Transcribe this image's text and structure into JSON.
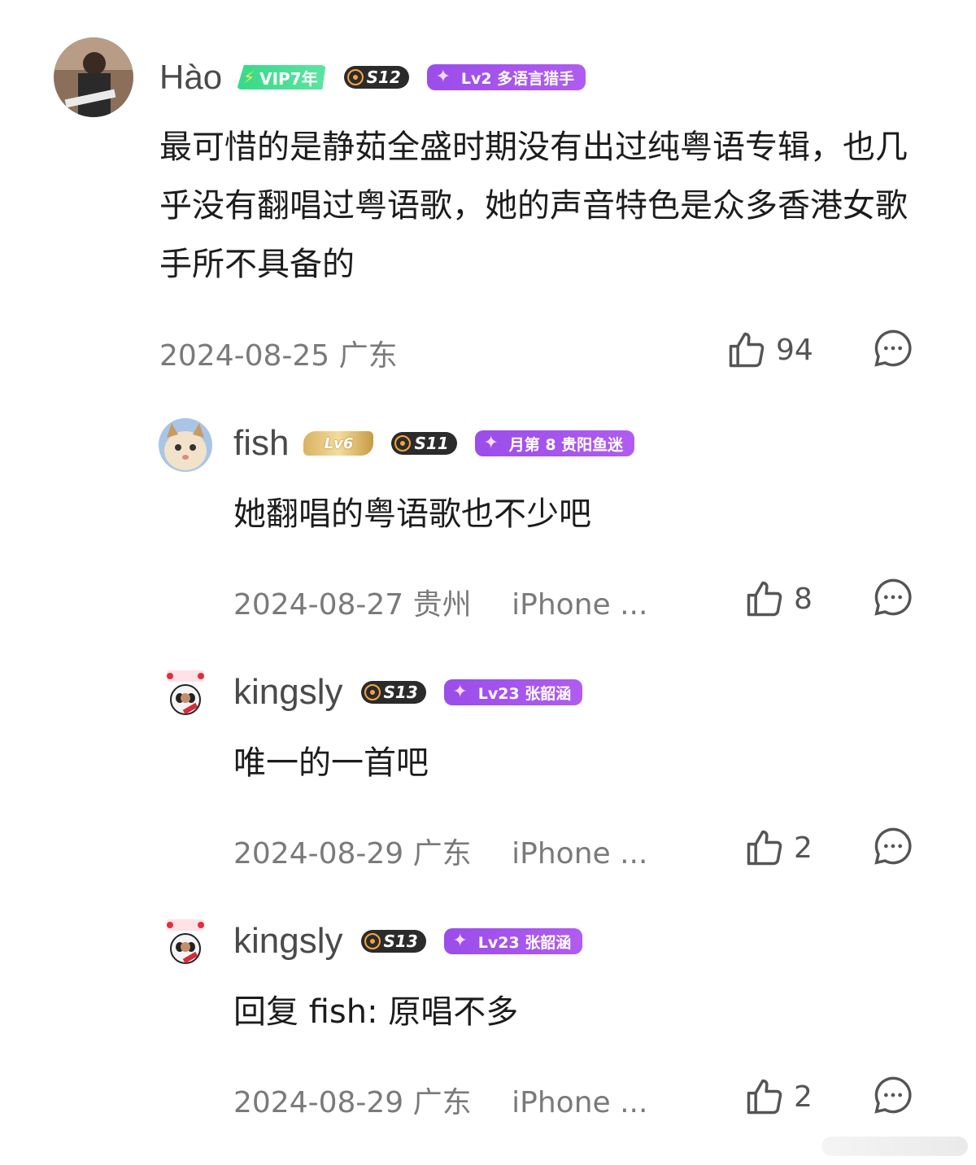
{
  "comments": [
    {
      "username": "Hào",
      "badges": {
        "vip": "VIP7年",
        "season": "S12",
        "fan": "Lv2 多语言猎手"
      },
      "text": "最可惜的是静茹全盛时期没有出过纯粤语专辑，也几乎没有翻唱过粤语歌，她的声音特色是众多香港女歌手所不具备的",
      "date": "2024-08-25",
      "location": "广东",
      "device": "",
      "likes": "94"
    },
    {
      "username": "fish",
      "badges": {
        "level": "Lv6",
        "season": "S11",
        "fan": "月第 8 贵阳鱼迷"
      },
      "text": "她翻唱的粤语歌也不少吧",
      "date": "2024-08-27",
      "location": "贵州",
      "device": "iPhone ...",
      "likes": "8"
    },
    {
      "username": "kingsly",
      "badges": {
        "season": "S13",
        "fan": "Lv23 张韶涵"
      },
      "text": "唯一的一首吧",
      "date": "2024-08-29",
      "location": "广东",
      "device": "iPhone ...",
      "likes": "2"
    },
    {
      "username": "kingsly",
      "badges": {
        "season": "S13",
        "fan": "Lv23 张韶涵"
      },
      "text": "回复 fish: 原唱不多",
      "date": "2024-08-29",
      "location": "广东",
      "device": "iPhone ...",
      "likes": "2"
    }
  ],
  "icons": {
    "like": "thumbs-up-icon",
    "reply": "comment-bubble-icon"
  },
  "colors": {
    "vip_green": "#37d98a",
    "fan_purple": "#9b4dea",
    "season_dark": "#2b2b2b",
    "meta_gray": "#7a7a7a"
  }
}
